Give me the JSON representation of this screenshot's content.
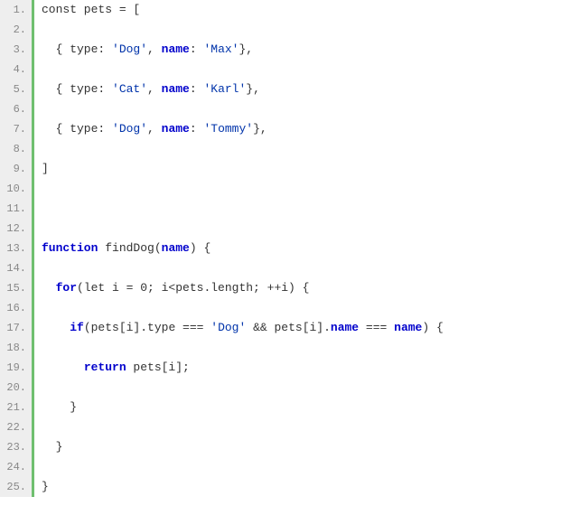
{
  "lineCount": 25,
  "lines": [
    [
      {
        "t": "const pets = [",
        "c": ""
      }
    ],
    [],
    [
      {
        "t": "  { type: ",
        "c": ""
      },
      {
        "t": "'Dog'",
        "c": "str"
      },
      {
        "t": ", ",
        "c": ""
      },
      {
        "t": "name",
        "c": "name"
      },
      {
        "t": ": ",
        "c": ""
      },
      {
        "t": "'Max'",
        "c": "str"
      },
      {
        "t": "},",
        "c": ""
      }
    ],
    [],
    [
      {
        "t": "  { type: ",
        "c": ""
      },
      {
        "t": "'Cat'",
        "c": "str"
      },
      {
        "t": ", ",
        "c": ""
      },
      {
        "t": "name",
        "c": "name"
      },
      {
        "t": ": ",
        "c": ""
      },
      {
        "t": "'Karl'",
        "c": "str"
      },
      {
        "t": "},",
        "c": ""
      }
    ],
    [],
    [
      {
        "t": "  { type: ",
        "c": ""
      },
      {
        "t": "'Dog'",
        "c": "str"
      },
      {
        "t": ", ",
        "c": ""
      },
      {
        "t": "name",
        "c": "name"
      },
      {
        "t": ": ",
        "c": ""
      },
      {
        "t": "'Tommy'",
        "c": "str"
      },
      {
        "t": "},",
        "c": ""
      }
    ],
    [],
    [
      {
        "t": "]",
        "c": ""
      }
    ],
    [],
    [],
    [],
    [
      {
        "t": "function",
        "c": "kw"
      },
      {
        "t": " findDog(",
        "c": ""
      },
      {
        "t": "name",
        "c": "name"
      },
      {
        "t": ") {",
        "c": ""
      }
    ],
    [],
    [
      {
        "t": "  ",
        "c": ""
      },
      {
        "t": "for",
        "c": "kw"
      },
      {
        "t": "(let i = 0; i<pets.length; ++i) {",
        "c": ""
      }
    ],
    [],
    [
      {
        "t": "    ",
        "c": ""
      },
      {
        "t": "if",
        "c": "kw"
      },
      {
        "t": "(pets[i].type === ",
        "c": ""
      },
      {
        "t": "'Dog'",
        "c": "str"
      },
      {
        "t": " && pets[i].",
        "c": ""
      },
      {
        "t": "name",
        "c": "name"
      },
      {
        "t": " === ",
        "c": ""
      },
      {
        "t": "name",
        "c": "name"
      },
      {
        "t": ") {",
        "c": ""
      }
    ],
    [],
    [
      {
        "t": "      ",
        "c": ""
      },
      {
        "t": "return",
        "c": "kw"
      },
      {
        "t": " pets[i];",
        "c": ""
      }
    ],
    [],
    [
      {
        "t": "    }",
        "c": ""
      }
    ],
    [],
    [
      {
        "t": "  }",
        "c": ""
      }
    ],
    [],
    [
      {
        "t": "}",
        "c": ""
      }
    ]
  ]
}
